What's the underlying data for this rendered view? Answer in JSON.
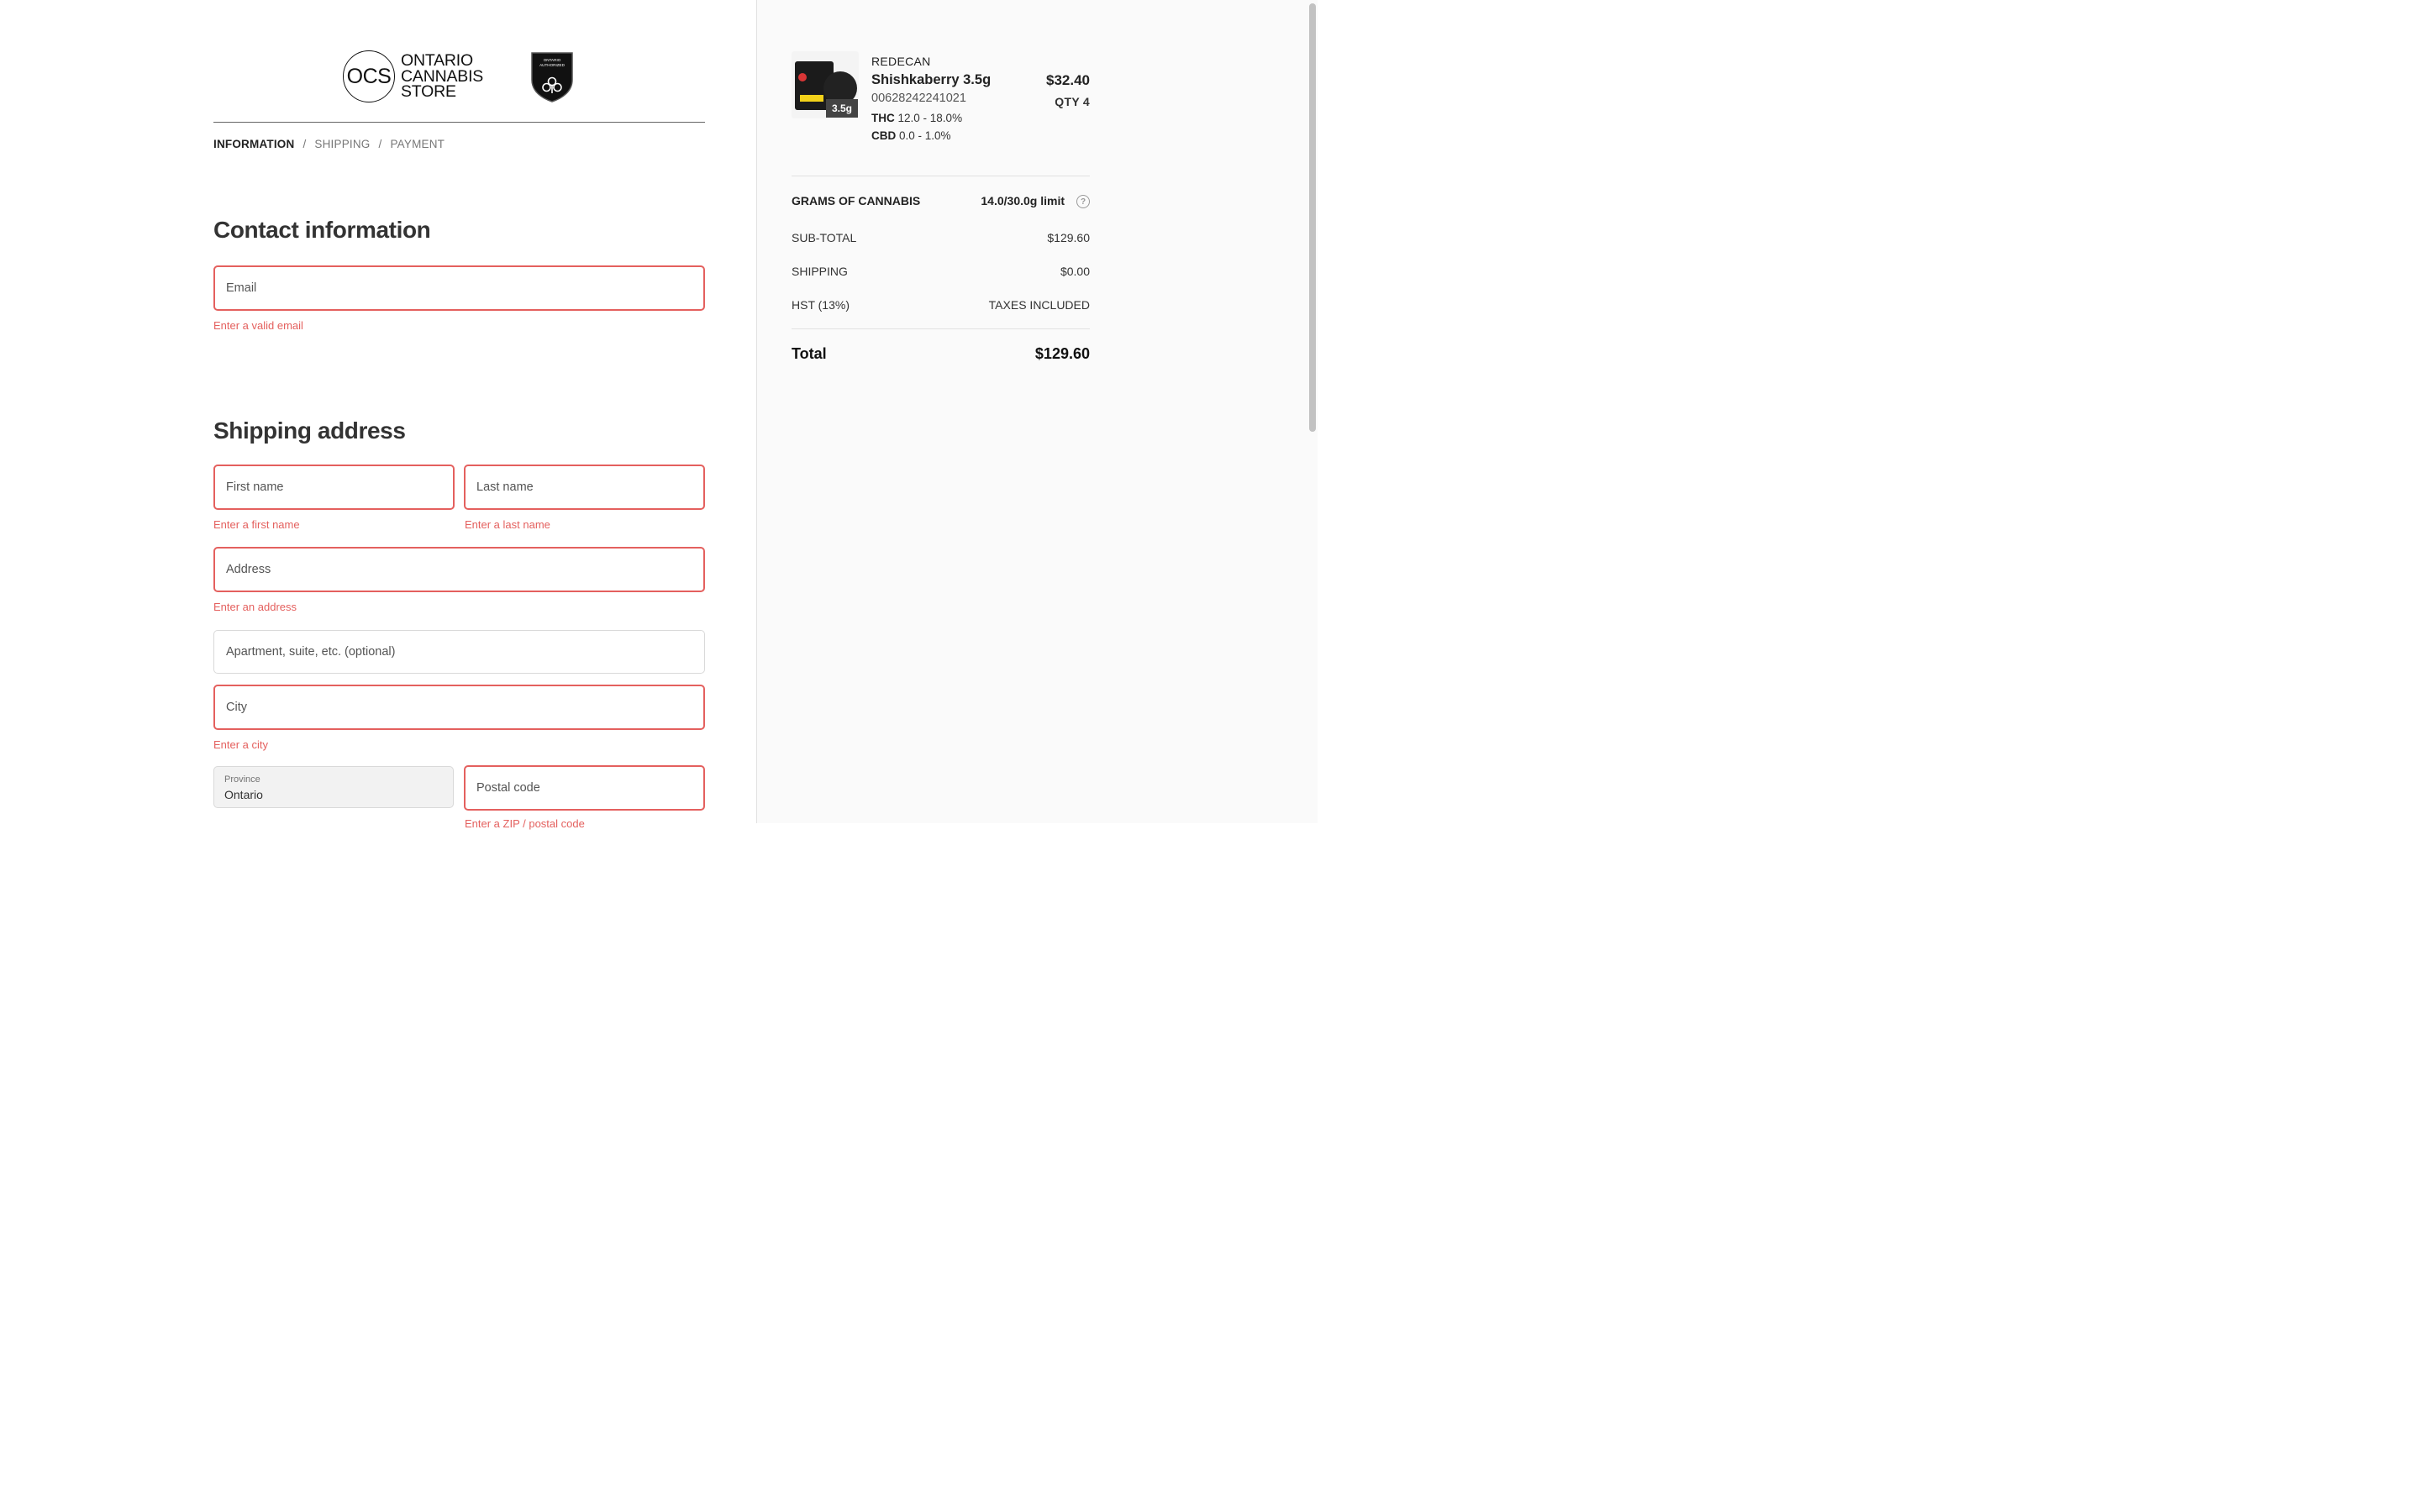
{
  "header": {
    "logo_mark": "OCS",
    "logo_text": [
      "ONTARIO",
      "CANNABIS",
      "STORE"
    ],
    "shield_text": [
      "ONTARIO",
      "AUTHORIZED"
    ]
  },
  "breadcrumb": {
    "steps": [
      "INFORMATION",
      "SHIPPING",
      "PAYMENT"
    ],
    "separator": "/",
    "active": "INFORMATION"
  },
  "contact": {
    "title": "Contact information",
    "email_placeholder": "Email",
    "email_error": "Enter a valid email"
  },
  "shipping": {
    "title": "Shipping address",
    "first_name_placeholder": "First name",
    "first_name_error": "Enter a first name",
    "last_name_placeholder": "Last name",
    "last_name_error": "Enter a last name",
    "address_placeholder": "Address",
    "address_error": "Enter an address",
    "apartment_placeholder": "Apartment, suite, etc. (optional)",
    "city_placeholder": "City",
    "city_error": "Enter a city",
    "province_label": "Province",
    "province_value": "Ontario",
    "postal_placeholder": "Postal code",
    "postal_error": "Enter a ZIP / postal code"
  },
  "summary": {
    "product": {
      "brand": "REDECAN",
      "name": "Shishkaberry 3.5g",
      "sku": "00628242241021",
      "thc_label": "THC",
      "thc_value": "12.0 - 18.0%",
      "cbd_label": "CBD",
      "cbd_value": "0.0 - 1.0%",
      "price": "$32.40",
      "qty": "QTY 4",
      "image_badge": "3.5g"
    },
    "grams_label": "GRAMS OF CANNABIS",
    "grams_value": "14.0/30.0g limit",
    "help_icon": "?",
    "subtotal_label": "SUB-TOTAL",
    "subtotal_value": "$129.60",
    "shipping_label": "SHIPPING",
    "shipping_value": "$0.00",
    "hst_label": "HST (13%)",
    "hst_value": "TAXES INCLUDED",
    "total_label": "Total",
    "total_value": "$129.60"
  },
  "colors": {
    "error": "#e4605e",
    "sidebar_bg": "#fafafa"
  }
}
